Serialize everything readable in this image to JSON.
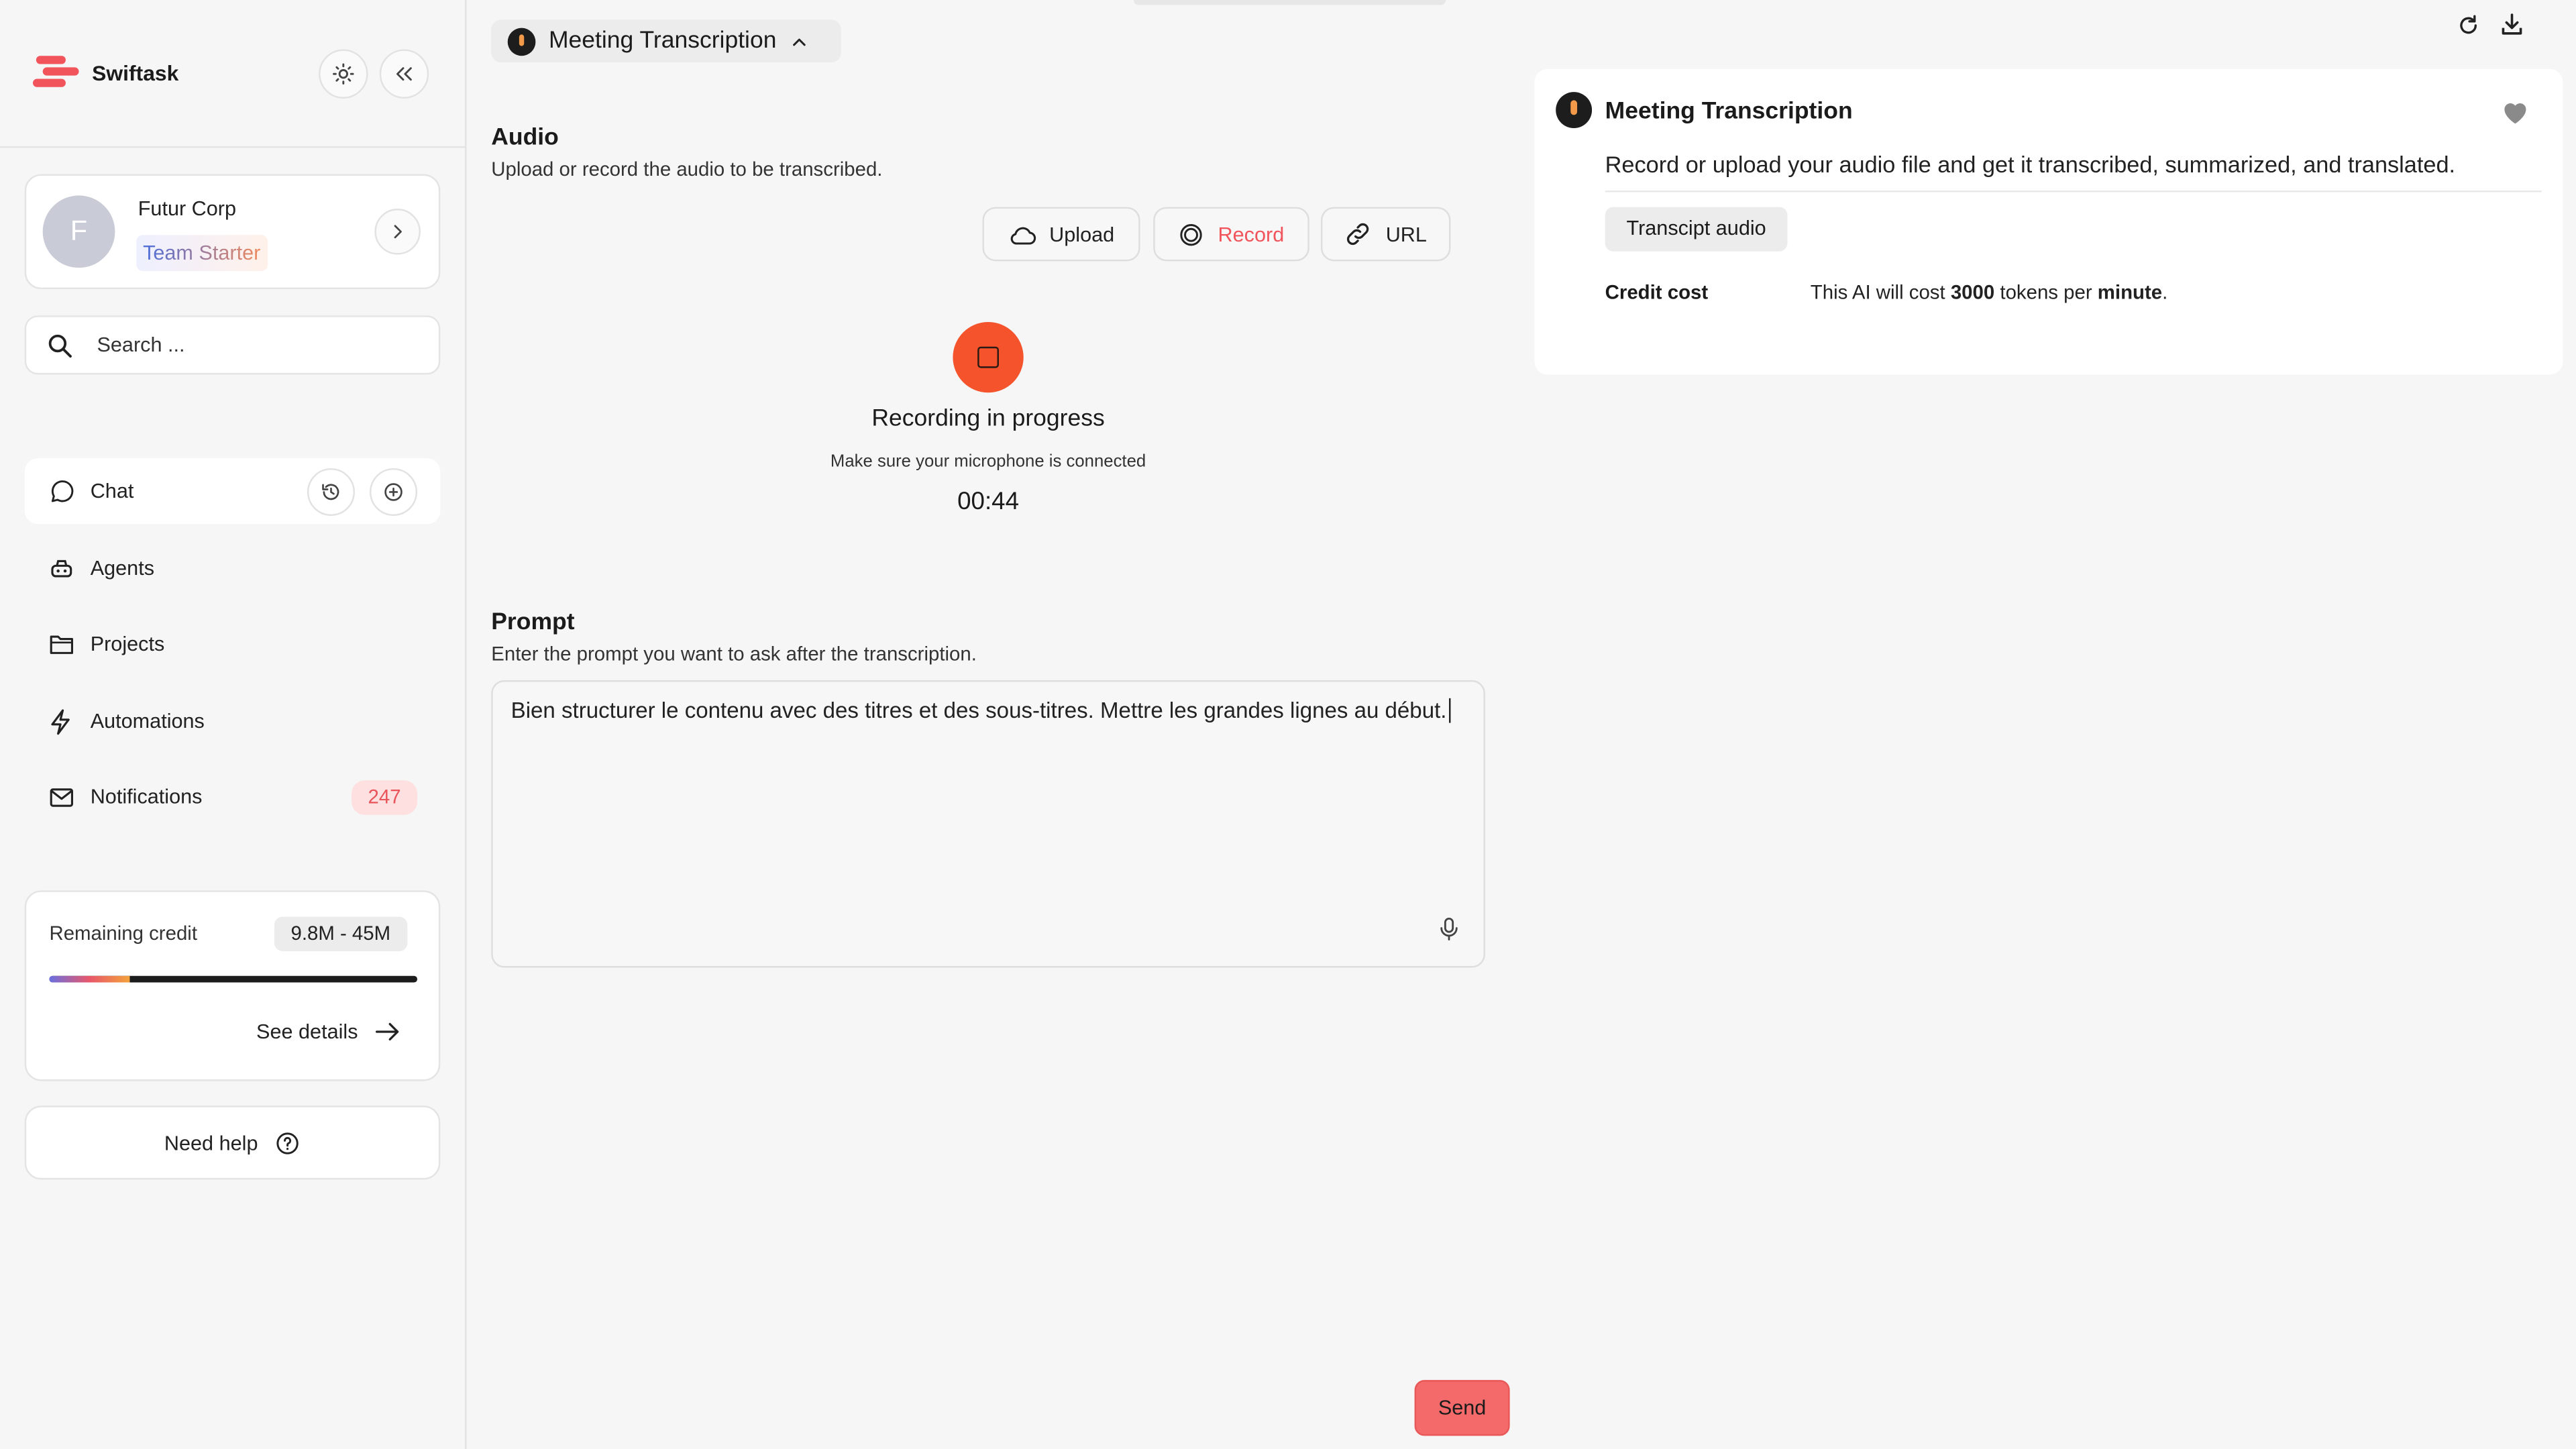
{
  "app": {
    "brand": "Swiftask"
  },
  "org": {
    "avatar_letter": "F",
    "name": "Futur Corp",
    "plan": "Team Starter"
  },
  "search": {
    "placeholder": "Search ..."
  },
  "nav": [
    {
      "label": "Chat"
    },
    {
      "label": "Agents"
    },
    {
      "label": "Projects"
    },
    {
      "label": "Automations"
    },
    {
      "label": "Notifications",
      "badge": "247"
    }
  ],
  "credit": {
    "label": "Remaining credit",
    "range": "9.8M - 45M",
    "fill_fraction": 0.22,
    "details": "See details"
  },
  "help": {
    "label": "Need help"
  },
  "model": {
    "name": "Meeting Transcription"
  },
  "audio": {
    "title": "Audio",
    "subtitle": "Upload or record the audio to be transcribed.",
    "buttons": {
      "upload": "Upload",
      "record": "Record",
      "url": "URL"
    }
  },
  "recording": {
    "title": "Recording in progress",
    "subtitle": "Make sure your microphone is connected",
    "time": "00:44"
  },
  "prompt": {
    "title": "Prompt",
    "subtitle": "Enter the prompt you want to ask after the transcription.",
    "value": "Bien structurer le contenu avec des titres et des sous-titres. Mettre les grandes lignes au début."
  },
  "send": {
    "label": "Send"
  },
  "info": {
    "title": "Meeting Transcription",
    "description": "Record or upload your audio file and get it transcribed, summarized, and translated.",
    "tag": "Transcipt audio",
    "cost_label": "Credit cost",
    "cost_prefix": "This AI will cost ",
    "cost_tokens": "3000",
    "cost_mid": " tokens per ",
    "cost_unit": "minute",
    "cost_suffix": "."
  },
  "colors": {
    "accent": "#f2545b",
    "record": "#f4532c",
    "send": "#f46a6a"
  }
}
